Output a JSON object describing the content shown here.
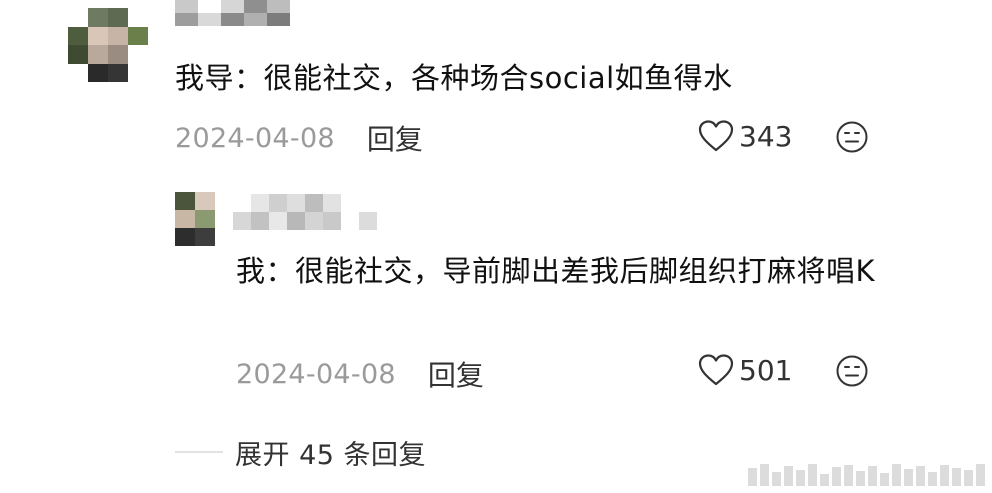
{
  "comment": {
    "text": "我导：很能社交，各种场合social如鱼得水",
    "date": "2024-04-08",
    "reply_label": "回复",
    "likes": "343",
    "like_icon": "heart-outline-icon",
    "emoji_icon": "neutral-face-icon"
  },
  "reply": {
    "text": "我：很能社交，导前脚出差我后脚组织打麻将唱K",
    "date": "2024-04-08",
    "reply_label": "回复",
    "likes": "501",
    "like_icon": "heart-outline-icon",
    "emoji_icon": "neutral-face-icon"
  },
  "expand": {
    "label": "展开 45 条回复"
  },
  "colors": {
    "text": "#111111",
    "meta": "#9a9a9a",
    "secondary": "#333333",
    "divider": "#e2e2e2"
  }
}
